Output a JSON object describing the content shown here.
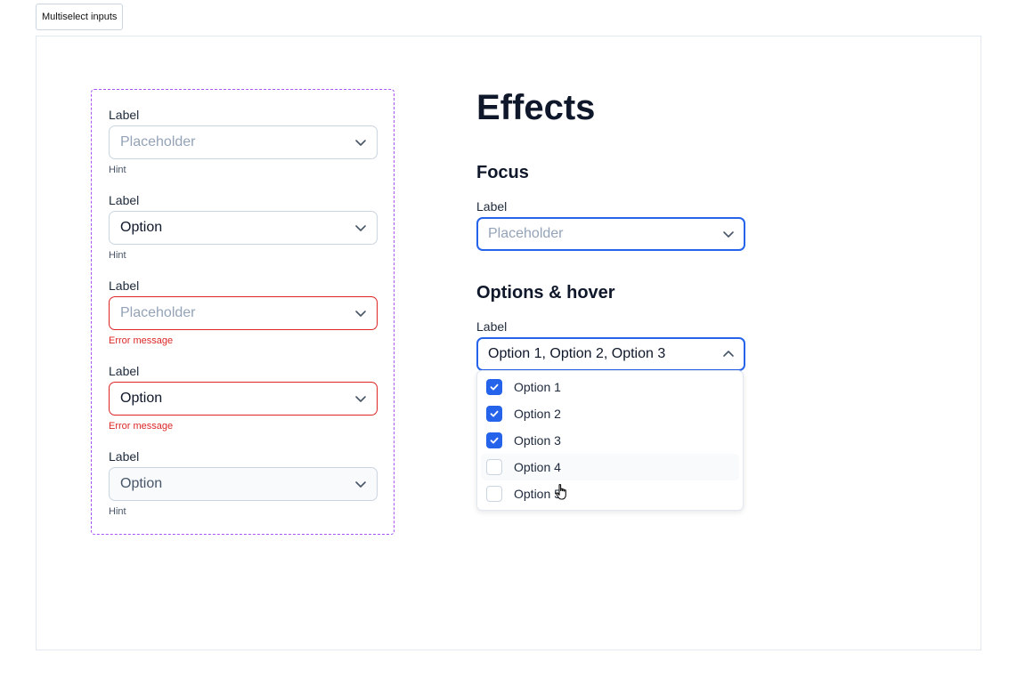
{
  "tab": {
    "label": "Multiselect inputs"
  },
  "variants": [
    {
      "label": "Label",
      "value": "Placeholder",
      "is_placeholder": true,
      "state": "default",
      "hint": "Hint"
    },
    {
      "label": "Label",
      "value": "Option",
      "is_placeholder": false,
      "state": "default",
      "hint": "Hint"
    },
    {
      "label": "Label",
      "value": "Placeholder",
      "is_placeholder": true,
      "state": "error",
      "hint": "Error message"
    },
    {
      "label": "Label",
      "value": "Option",
      "is_placeholder": false,
      "state": "error",
      "hint": "Error message"
    },
    {
      "label": "Label",
      "value": "Option",
      "is_placeholder": false,
      "state": "disabled",
      "hint": "Hint"
    }
  ],
  "effects": {
    "title": "Effects",
    "focus": {
      "heading": "Focus",
      "label": "Label",
      "placeholder": "Placeholder"
    },
    "options_hover": {
      "heading": "Options & hover",
      "label": "Label",
      "value": "Option 1, Option 2, Option 3",
      "options": [
        {
          "label": "Option 1",
          "checked": true,
          "hovered": false
        },
        {
          "label": "Option 2",
          "checked": true,
          "hovered": false
        },
        {
          "label": "Option 3",
          "checked": true,
          "hovered": false
        },
        {
          "label": "Option 4",
          "checked": false,
          "hovered": true
        },
        {
          "label": "Option 5",
          "checked": false,
          "hovered": false
        }
      ]
    }
  },
  "colors": {
    "focus_border": "#2563eb",
    "error": "#dc2626",
    "checkbox_checked": "#2563eb",
    "variants_outline": "#a855f7",
    "placeholder": "#94a3b8"
  },
  "icons": {
    "chevron_closed": "chevron-down-icon",
    "chevron_open": "chevron-up-icon",
    "check": "check-icon",
    "cursor": "pointer-hand-cursor-icon"
  }
}
